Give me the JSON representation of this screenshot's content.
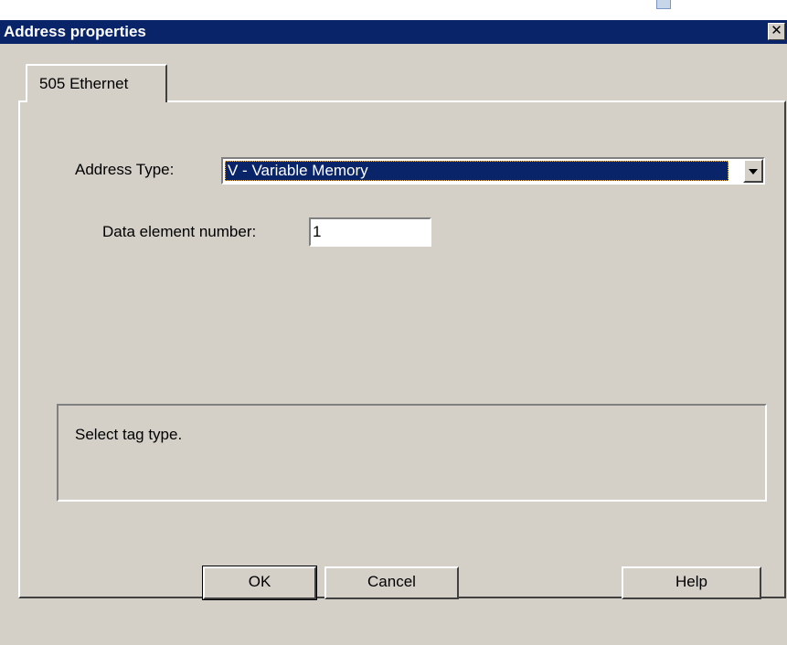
{
  "window": {
    "title": "Address properties",
    "close_glyph": "✕"
  },
  "tabs": [
    {
      "label": "505 Ethernet",
      "active": true
    }
  ],
  "form": {
    "address_type": {
      "label": "Address Type:",
      "selected": "V - Variable Memory"
    },
    "data_element": {
      "label": "Data element number:",
      "value": "1"
    }
  },
  "status": {
    "text": "Select tag type."
  },
  "buttons": {
    "ok": "OK",
    "cancel": "Cancel",
    "help": "Help"
  },
  "colors": {
    "title_bar": "#0a246a",
    "face": "#d4d0c8",
    "selection": "#0a246a"
  },
  "icons": {
    "close": "close-icon",
    "dropdown": "chevron-down-icon"
  }
}
